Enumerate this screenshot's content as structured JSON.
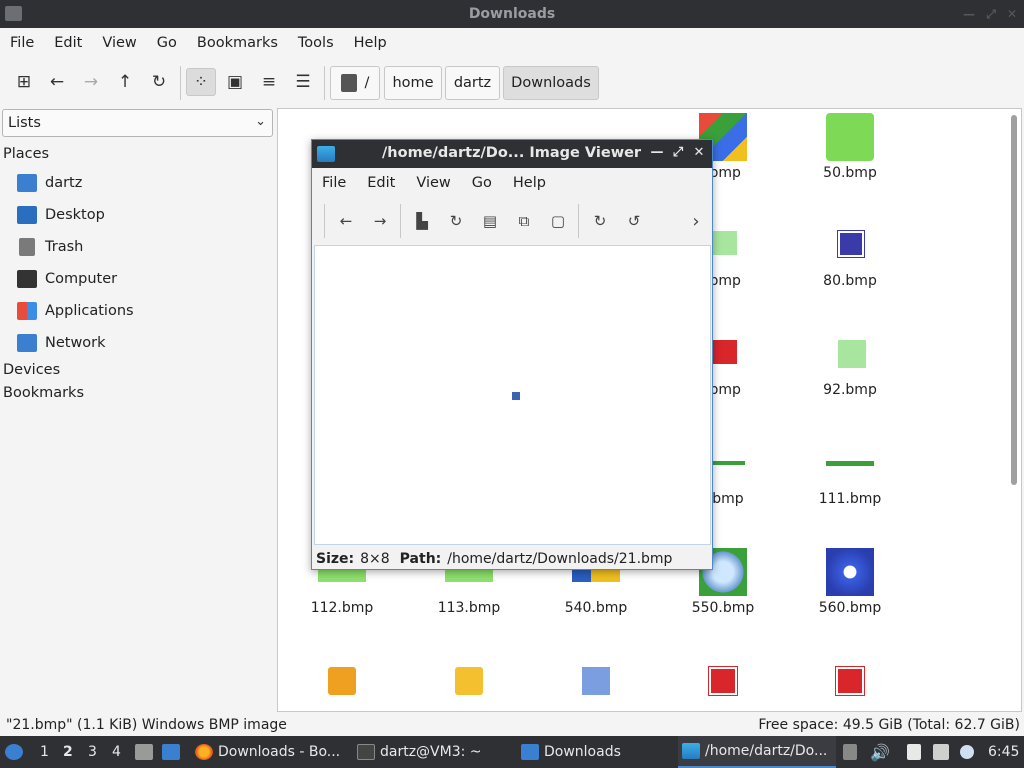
{
  "window": {
    "title": "Downloads"
  },
  "menu": [
    "File",
    "Edit",
    "View",
    "Go",
    "Bookmarks",
    "Tools",
    "Help"
  ],
  "path": {
    "root": "/",
    "crumbs": [
      "home",
      "dartz",
      "Downloads"
    ]
  },
  "sidebar": {
    "selector": "Lists",
    "places_header": "Places",
    "places": [
      {
        "label": "dartz",
        "icon": "home-folder-icon"
      },
      {
        "label": "Desktop",
        "icon": "desktop-icon"
      },
      {
        "label": "Trash",
        "icon": "trash-icon"
      },
      {
        "label": "Computer",
        "icon": "computer-icon"
      },
      {
        "label": "Applications",
        "icon": "applications-icon"
      },
      {
        "label": "Network",
        "icon": "network-icon"
      }
    ],
    "devices_header": "Devices",
    "bookmarks_header": "Bookmarks"
  },
  "files": [
    ".bmp",
    "50.bmp",
    ".bmp",
    "80.bmp",
    ".bmp",
    "92.bmp",
    ").bmp",
    "111.bmp",
    "112.bmp",
    "113.bmp",
    "540.bmp",
    "550.bmp",
    "560.bmp"
  ],
  "status": {
    "left": "\"21.bmp\" (1.1 KiB) Windows BMP image",
    "right": "Free space: 49.5 GiB (Total: 62.7 GiB)"
  },
  "viewer": {
    "title": "/home/dartz/Do... Image Viewer",
    "menu": [
      "File",
      "Edit",
      "View",
      "Go",
      "Help"
    ],
    "size_label": "Size:",
    "size_value": "8×8",
    "path_label": "Path:",
    "path_value": "/home/dartz/Downloads/21.bmp"
  },
  "taskbar": {
    "workspaces": [
      "1",
      "2",
      "3",
      "4"
    ],
    "tasks": [
      "Downloads - Bo...",
      "dartz@VM3: ~",
      "Downloads",
      "/home/dartz/Do..."
    ],
    "clock": "6:45"
  }
}
